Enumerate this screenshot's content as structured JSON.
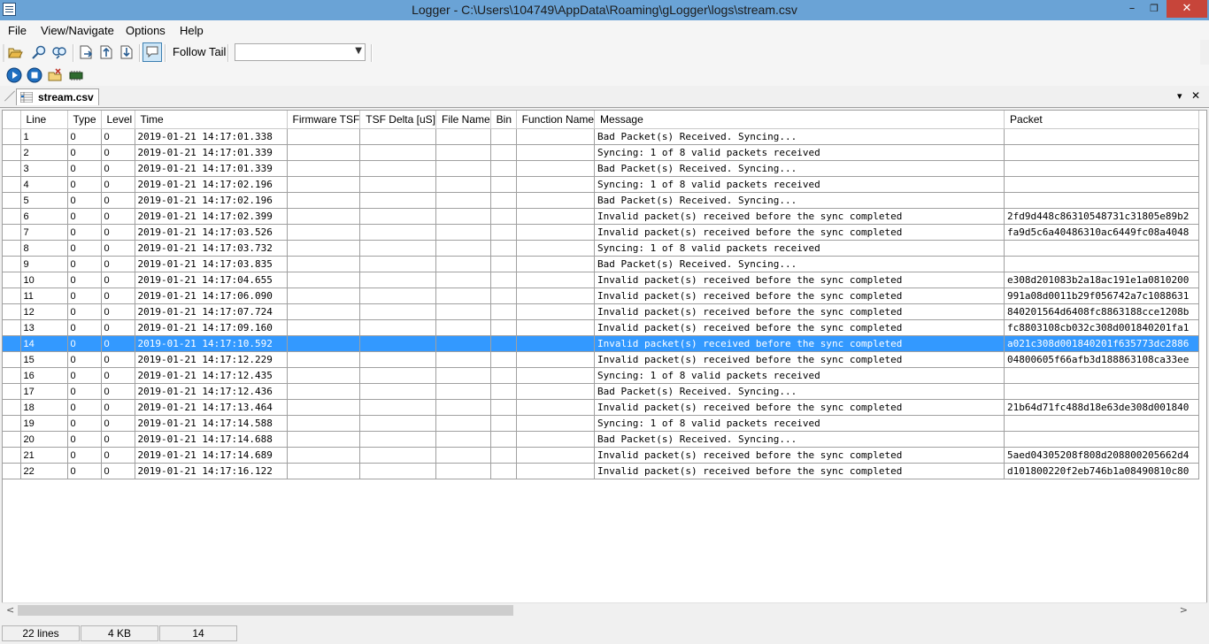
{
  "window": {
    "title": "Logger - C:\\Users\\104749\\AppData\\Roaming\\gLogger\\logs\\stream.csv",
    "minimize": "–",
    "maximize": "❐",
    "close": "✕"
  },
  "menu": [
    "File",
    "View/Navigate",
    "Options",
    "Help"
  ],
  "toolbar": {
    "follow_tail_label": "Follow Tail",
    "combo_value": ""
  },
  "tab": {
    "label": "stream.csv",
    "dropdown": "▾",
    "close": "✕"
  },
  "grid": {
    "columns": [
      "Line",
      "Type",
      "Level",
      "Time",
      "Firmware TSF",
      "TSF Delta [uS]",
      "File Name",
      "Bin",
      "Function Name",
      "Message",
      "Packet"
    ],
    "selected_line": "14",
    "rows": [
      [
        "1",
        "0",
        "0",
        "2019-01-21 14:17:01.338",
        "",
        "",
        "",
        "",
        "",
        "Bad Packet(s) Received. Syncing...",
        ""
      ],
      [
        "2",
        "0",
        "0",
        "2019-01-21 14:17:01.339",
        "",
        "",
        "",
        "",
        "",
        "Syncing: 1 of 8 valid packets received",
        ""
      ],
      [
        "3",
        "0",
        "0",
        "2019-01-21 14:17:01.339",
        "",
        "",
        "",
        "",
        "",
        "Bad Packet(s) Received. Syncing...",
        ""
      ],
      [
        "4",
        "0",
        "0",
        "2019-01-21 14:17:02.196",
        "",
        "",
        "",
        "",
        "",
        "Syncing: 1 of 8 valid packets received",
        ""
      ],
      [
        "5",
        "0",
        "0",
        "2019-01-21 14:17:02.196",
        "",
        "",
        "",
        "",
        "",
        "Bad Packet(s) Received. Syncing...",
        ""
      ],
      [
        "6",
        "0",
        "0",
        "2019-01-21 14:17:02.399",
        "",
        "",
        "",
        "",
        "",
        "Invalid packet(s) received before the sync completed",
        "2fd9d448c86310548731c31805e89b2"
      ],
      [
        "7",
        "0",
        "0",
        "2019-01-21 14:17:03.526",
        "",
        "",
        "",
        "",
        "",
        "Invalid packet(s) received before the sync completed",
        "fa9d5c6a40486310ac6449fc08a4048"
      ],
      [
        "8",
        "0",
        "0",
        "2019-01-21 14:17:03.732",
        "",
        "",
        "",
        "",
        "",
        "Syncing: 1 of 8 valid packets received",
        ""
      ],
      [
        "9",
        "0",
        "0",
        "2019-01-21 14:17:03.835",
        "",
        "",
        "",
        "",
        "",
        "Bad Packet(s) Received. Syncing...",
        ""
      ],
      [
        "10",
        "0",
        "0",
        "2019-01-21 14:17:04.655",
        "",
        "",
        "",
        "",
        "",
        "Invalid packet(s) received before the sync completed",
        "e308d201083b2a18ac191e1a0810200"
      ],
      [
        "11",
        "0",
        "0",
        "2019-01-21 14:17:06.090",
        "",
        "",
        "",
        "",
        "",
        "Invalid packet(s) received before the sync completed",
        "991a08d0011b29f056742a7c1088631"
      ],
      [
        "12",
        "0",
        "0",
        "2019-01-21 14:17:07.724",
        "",
        "",
        "",
        "",
        "",
        "Invalid packet(s) received before the sync completed",
        "840201564d6408fc8863188cce1208b"
      ],
      [
        "13",
        "0",
        "0",
        "2019-01-21 14:17:09.160",
        "",
        "",
        "",
        "",
        "",
        "Invalid packet(s) received before the sync completed",
        "fc8803108cb032c308d001840201fa1"
      ],
      [
        "14",
        "0",
        "0",
        "2019-01-21 14:17:10.592",
        "",
        "",
        "",
        "",
        "",
        "Invalid packet(s) received before the sync completed",
        "a021c308d001840201f635773dc2886"
      ],
      [
        "15",
        "0",
        "0",
        "2019-01-21 14:17:12.229",
        "",
        "",
        "",
        "",
        "",
        "Invalid packet(s) received before the sync completed",
        "04800605f66afb3d188863108ca33ee"
      ],
      [
        "16",
        "0",
        "0",
        "2019-01-21 14:17:12.435",
        "",
        "",
        "",
        "",
        "",
        "Syncing: 1 of 8 valid packets received",
        ""
      ],
      [
        "17",
        "0",
        "0",
        "2019-01-21 14:17:12.436",
        "",
        "",
        "",
        "",
        "",
        "Bad Packet(s) Received. Syncing...",
        ""
      ],
      [
        "18",
        "0",
        "0",
        "2019-01-21 14:17:13.464",
        "",
        "",
        "",
        "",
        "",
        "Invalid packet(s) received before the sync completed",
        "21b64d71fc488d18e63de308d001840"
      ],
      [
        "19",
        "0",
        "0",
        "2019-01-21 14:17:14.588",
        "",
        "",
        "",
        "",
        "",
        "Syncing: 1 of 8 valid packets received",
        ""
      ],
      [
        "20",
        "0",
        "0",
        "2019-01-21 14:17:14.688",
        "",
        "",
        "",
        "",
        "",
        "Bad Packet(s) Received. Syncing...",
        ""
      ],
      [
        "21",
        "0",
        "0",
        "2019-01-21 14:17:14.689",
        "",
        "",
        "",
        "",
        "",
        "Invalid packet(s) received before the sync completed",
        "5aed04305208f808d208800205662d4"
      ],
      [
        "22",
        "0",
        "0",
        "2019-01-21 14:17:16.122",
        "",
        "",
        "",
        "",
        "",
        "Invalid packet(s) received before the sync completed",
        "d101800220f2eb746b1a08490810c80"
      ]
    ]
  },
  "scrollbar": {
    "left_arrow": "<",
    "right_arrow": ">"
  },
  "status": {
    "lines": "22 lines",
    "size": "4 KB",
    "selected": "14"
  },
  "icons": [
    "open-folder-icon",
    "find-icon",
    "find-next-icon",
    "export-icon",
    "import-icon",
    "save-icon",
    "comment-icon",
    "play-icon",
    "stop-icon",
    "clear-log-icon",
    "chip-icon"
  ],
  "colors": {
    "titlebar": "#6aa3d6",
    "selection": "#3399ff",
    "close": "#c7453a"
  }
}
